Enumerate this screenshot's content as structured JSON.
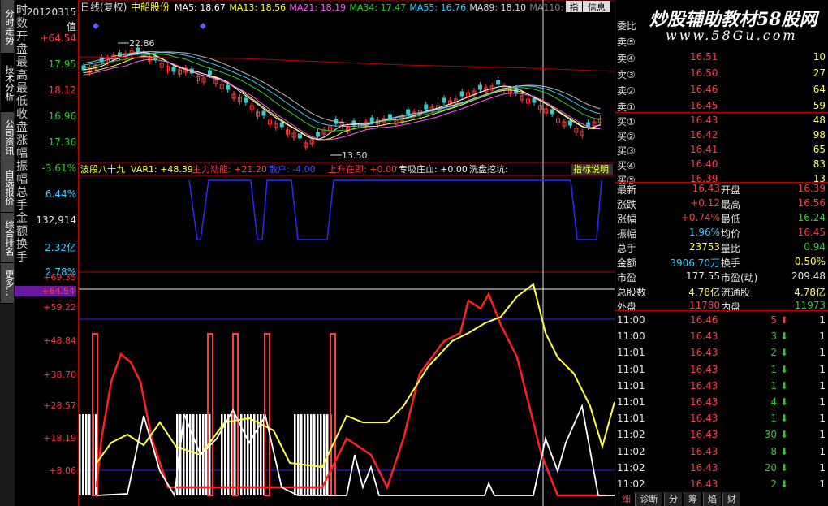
{
  "app": {
    "window_buttons": [
      "指",
      "信息"
    ]
  },
  "side_tabs": [
    "分时走势",
    "技术分析",
    "公司资讯",
    "自选报价",
    "综合排名",
    "更多..."
  ],
  "info_panel": {
    "rows": [
      {
        "label": "时",
        "value": "20120315"
      },
      {
        "label": "数",
        "value": "值"
      },
      {
        "label": "开",
        "value": "+64.54"
      },
      {
        "label": "盘",
        "value": ""
      },
      {
        "label": "最",
        "value": "17.95"
      },
      {
        "label": "高",
        "value": ""
      },
      {
        "label": "最",
        "value": "18.12"
      },
      {
        "label": "低",
        "value": ""
      },
      {
        "label": "收",
        "value": "16.96"
      },
      {
        "label": "盘",
        "value": ""
      },
      {
        "label": "涨",
        "value": "17.36"
      },
      {
        "label": "幅",
        "value": ""
      },
      {
        "label": "振",
        "value": "-3.61%"
      },
      {
        "label": "幅",
        "value": ""
      },
      {
        "label": "总",
        "value": "6.44%"
      },
      {
        "label": "手",
        "value": ""
      },
      {
        "label": "金",
        "value": "132,914"
      },
      {
        "label": "额",
        "value": ""
      },
      {
        "label": "换",
        "value": "2.32亿"
      },
      {
        "label": "手",
        "value": ""
      },
      {
        "label": "",
        "value": "2.78%"
      }
    ]
  },
  "price_chart": {
    "header": {
      "period": "日线(复权)",
      "stock_name": "中船股份"
    },
    "ma": [
      {
        "name": "MA5:",
        "value": "18.67",
        "color": "#ffffff"
      },
      {
        "name": "MA13:",
        "value": "18.56",
        "color": "#ffff3c"
      },
      {
        "name": "MA21:",
        "value": "18.19",
        "color": "#ff5aff"
      },
      {
        "name": "MA34:",
        "value": "17.47",
        "color": "#32c832"
      },
      {
        "name": "MA55:",
        "value": "16.76",
        "color": "#3cc8ff"
      },
      {
        "name": "MA89:",
        "value": "18.10",
        "color": "#dddddd"
      },
      {
        "name": "MA110:",
        "value": "18.",
        "color": "#888888"
      }
    ],
    "high_label": "22.86",
    "low_label": "13.50"
  },
  "indicator_header": {
    "name": "波段八十九",
    "var1": "VAR1: +48.39",
    "items": [
      {
        "text": "主力动能: +21.20",
        "color": "#ff3b3b"
      },
      {
        "text": "散户: -4.00",
        "color": "#3c50ff"
      },
      {
        "text": "上升在即: +0.00",
        "color": "#ff3b3b"
      },
      {
        "text": "专吸庄血: +0.00",
        "color": "#e6e6e6"
      },
      {
        "text": "洗盘挖坑:",
        "color": "#e6e6e6"
      }
    ],
    "explain_button": "指标说明"
  },
  "lower_axis": [
    "+69.35",
    "+64.54",
    "+59.22",
    "+48.84",
    "+38.70",
    "+28.57",
    "+18.19",
    "+8.06"
  ],
  "watermark": "炒股辅助教材58股网",
  "watermark_url": "www.58Gu.com",
  "order_book": {
    "title": "委比",
    "sells": [
      {
        "label": "卖⑤",
        "price": "",
        "volume": ""
      },
      {
        "label": "卖④",
        "price": "16.51",
        "volume": "10"
      },
      {
        "label": "卖③",
        "price": "16.50",
        "volume": "27"
      },
      {
        "label": "卖②",
        "price": "16.46",
        "volume": "64"
      },
      {
        "label": "卖①",
        "price": "16.45",
        "volume": "59"
      }
    ],
    "buys": [
      {
        "label": "买①",
        "price": "16.43",
        "volume": "48"
      },
      {
        "label": "买②",
        "price": "16.42",
        "volume": "98"
      },
      {
        "label": "买③",
        "price": "16.41",
        "volume": "65"
      },
      {
        "label": "买④",
        "price": "16.40",
        "volume": "83"
      },
      {
        "label": "买⑤",
        "price": "16.39",
        "volume": "13"
      }
    ]
  },
  "quote": [
    {
      "l1": "最新",
      "v1": "16.43",
      "c1": "#ff3b3b",
      "l2": "开盘",
      "v2": "16.39",
      "c2": "#ff3b3b"
    },
    {
      "l1": "涨跌",
      "v1": "+0.12",
      "c1": "#ff3b3b",
      "l2": "最高",
      "v2": "16.56",
      "c2": "#ff3b3b"
    },
    {
      "l1": "涨幅",
      "v1": "+0.74%",
      "c1": "#ff3b3b",
      "l2": "最低",
      "v2": "16.24",
      "c2": "#32c832"
    },
    {
      "l1": "振幅",
      "v1": "1.96%",
      "c1": "#3cc8ff",
      "l2": "均价",
      "v2": "16.45",
      "c2": "#ff3b3b"
    },
    {
      "l1": "总手",
      "v1": "23753",
      "c1": "#ffff3c",
      "l2": "量比",
      "v2": "0.94",
      "c2": "#32c832"
    },
    {
      "l1": "金额",
      "v1": "3906.70万",
      "c1": "#3cc8ff",
      "l2": "换手",
      "v2": "0.50%",
      "c2": "#ffff3c"
    },
    {
      "l1": "市盈",
      "v1": "177.55",
      "c1": "#e6e6e6",
      "l2": "市盈(动)",
      "v2": "209.48",
      "c2": "#e6e6e6"
    },
    {
      "l1": "总股数",
      "v1": "4.78亿",
      "c1": "#ffff3c",
      "l2": "流通股",
      "v2": "4.78亿",
      "c2": "#ffff3c"
    },
    {
      "l1": "外盘",
      "v1": "11780",
      "c1": "#ff3b3b",
      "l2": "内盘",
      "v2": "11973",
      "c2": "#32c832"
    }
  ],
  "ticks": [
    {
      "time": "11:00",
      "price": "16.46",
      "vol": "5",
      "dir": "up",
      "n": "1"
    },
    {
      "time": "11:00",
      "price": "16.43",
      "vol": "3",
      "dir": "down",
      "n": "1"
    },
    {
      "time": "11:01",
      "price": "16.43",
      "vol": "2",
      "dir": "down",
      "n": "1"
    },
    {
      "time": "11:01",
      "price": "16.43",
      "vol": "1",
      "dir": "down",
      "n": "1"
    },
    {
      "time": "11:01",
      "price": "16.43",
      "vol": "1",
      "dir": "down",
      "n": "1"
    },
    {
      "time": "11:01",
      "price": "16.43",
      "vol": "4",
      "dir": "down",
      "n": "1"
    },
    {
      "time": "11:01",
      "price": "16.43",
      "vol": "1",
      "dir": "down",
      "n": "1"
    },
    {
      "time": "11:02",
      "price": "16.43",
      "vol": "30",
      "dir": "down",
      "n": "1"
    },
    {
      "time": "11:02",
      "price": "16.43",
      "vol": "8",
      "dir": "down",
      "n": "1"
    },
    {
      "time": "11:02",
      "price": "16.43",
      "vol": "20",
      "dir": "down",
      "n": "1"
    },
    {
      "time": "11:02",
      "price": "16.43",
      "vol": "2",
      "dir": "down",
      "n": "1"
    }
  ],
  "bottom_tabs": [
    "细",
    "诊断",
    "分",
    "筹",
    "焰",
    "财"
  ]
}
